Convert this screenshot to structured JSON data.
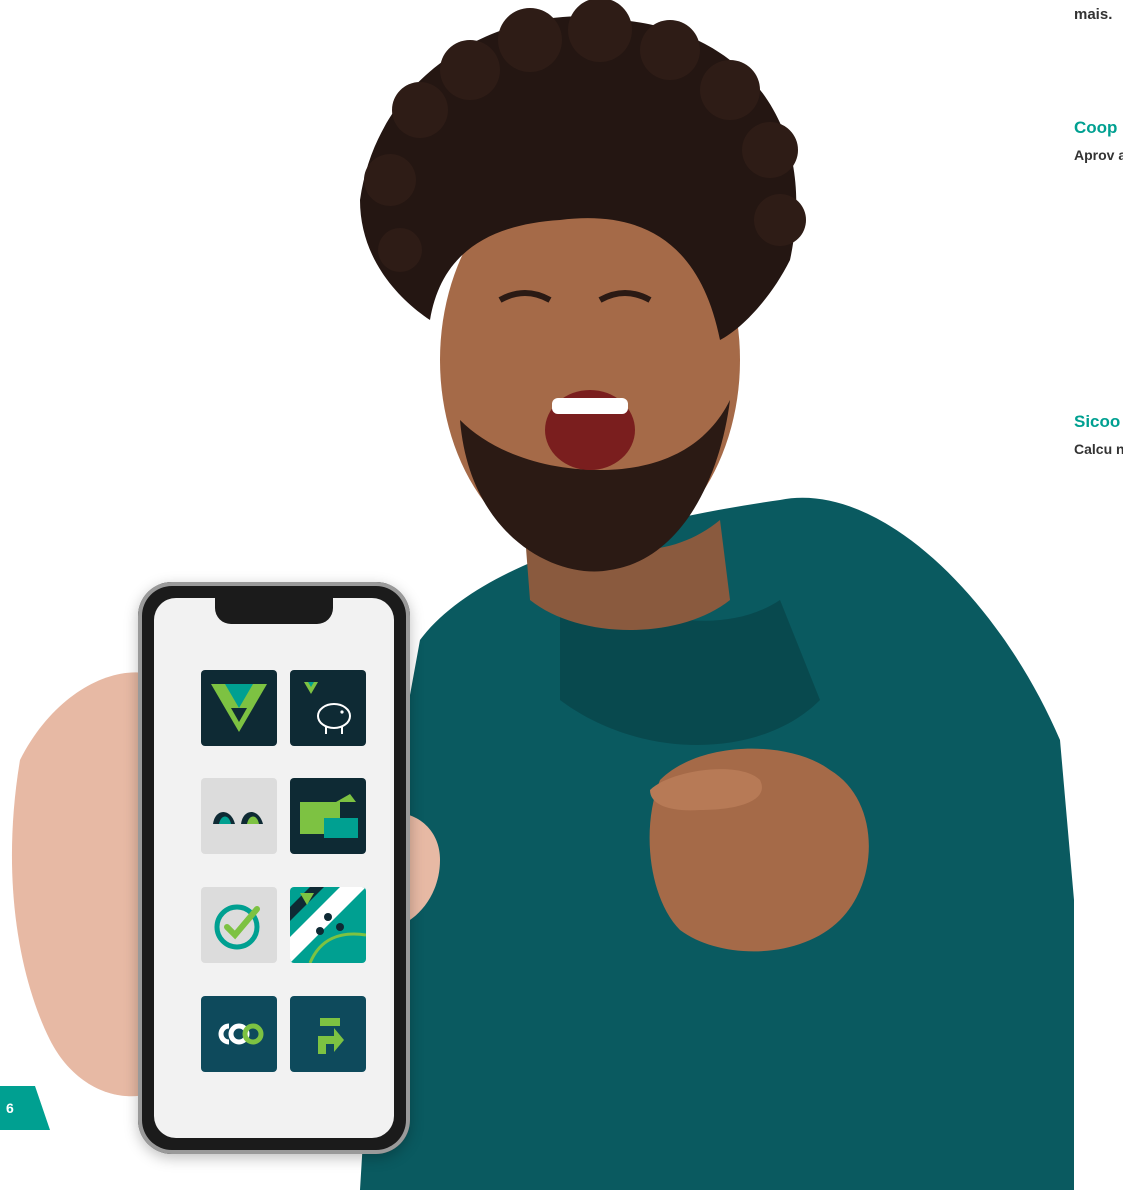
{
  "page": {
    "number": "6"
  },
  "side_text": {
    "intro_tail": "mais.",
    "section1_title": "Coop",
    "section1_body": "Aprov a ca Sicoo para opçõe conta",
    "section2_title": "Sicoo",
    "section2_body": "Calcu nanci"
  },
  "phone": {
    "apps": [
      {
        "icon": "sicoob-logo-app-icon"
      },
      {
        "icon": "piggy-bank-app-icon"
      },
      {
        "icon": "moob-app-icon"
      },
      {
        "icon": "wallet-card-app-icon"
      },
      {
        "icon": "checkmark-app-icon"
      },
      {
        "icon": "map-pins-app-icon"
      },
      {
        "icon": "coop-app-icon"
      },
      {
        "icon": "transfer-arrow-app-icon"
      }
    ]
  },
  "colors": {
    "brand_teal": "#00a091",
    "dark_navy": "#0e2a34",
    "lime": "#7dc242",
    "shirt": "#0a5a60"
  }
}
